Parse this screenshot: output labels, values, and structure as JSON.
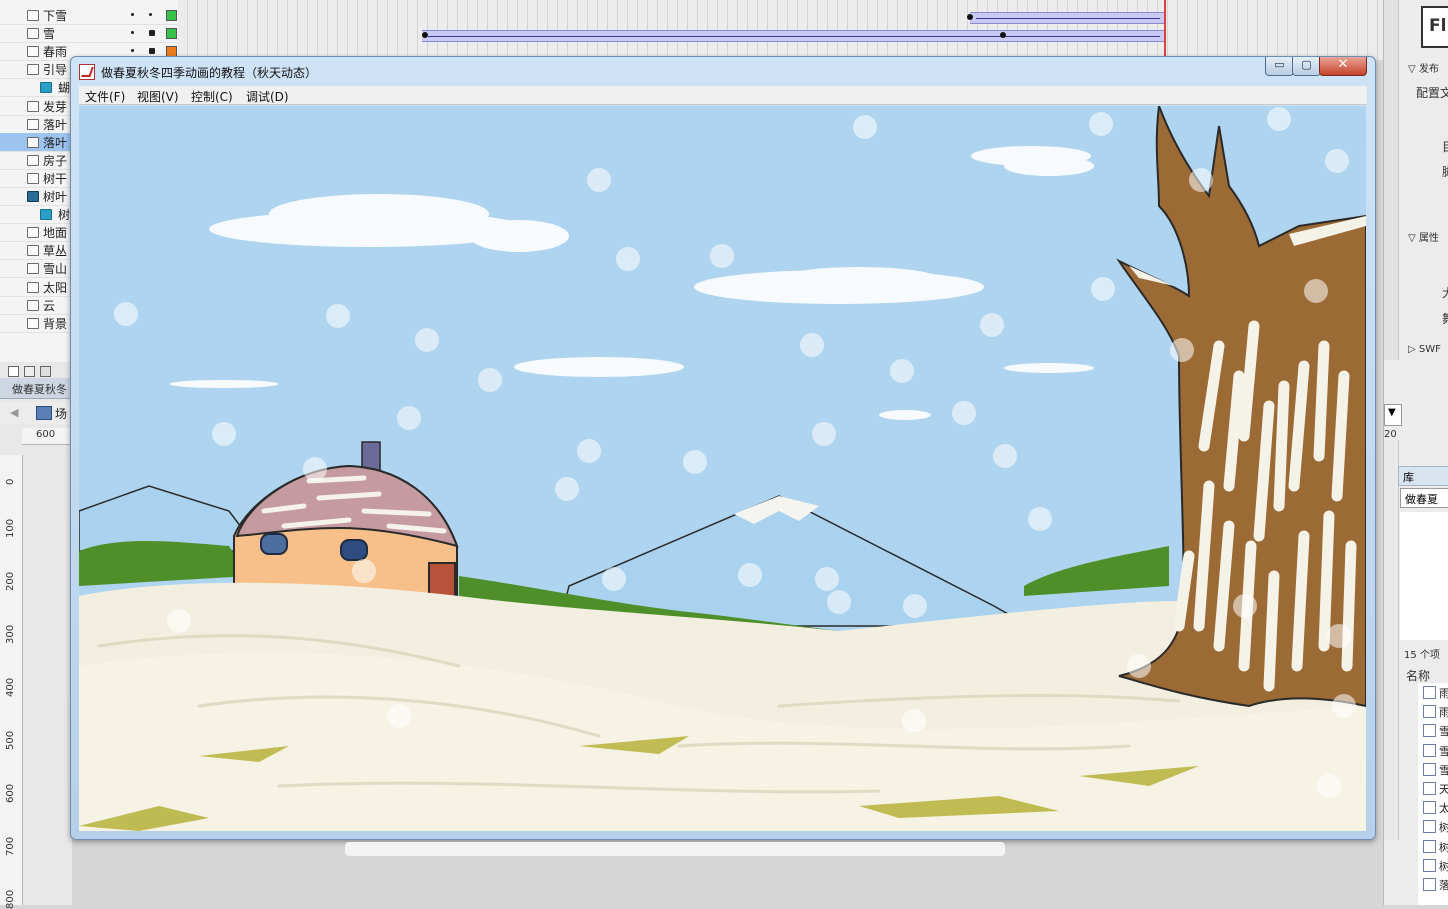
{
  "layers": [
    {
      "name": "下雪",
      "type": "layer",
      "color": "#39c24a"
    },
    {
      "name": "雪",
      "type": "layer",
      "color": "#39c24a"
    },
    {
      "name": "春雨",
      "type": "layer",
      "color": "#ef7b1e"
    },
    {
      "name": "引导",
      "type": "guide",
      "color": ""
    },
    {
      "name": "蝴",
      "type": "sub",
      "color": ""
    },
    {
      "name": "发芽",
      "type": "layer",
      "color": ""
    },
    {
      "name": "落叶",
      "type": "layer",
      "color": ""
    },
    {
      "name": "落叶",
      "type": "layer",
      "color": "",
      "selected": true
    },
    {
      "name": "房子",
      "type": "layer",
      "color": ""
    },
    {
      "name": "树干",
      "type": "layer",
      "color": ""
    },
    {
      "name": "树叶",
      "type": "folder",
      "color": ""
    },
    {
      "name": "树",
      "type": "sub",
      "color": ""
    },
    {
      "name": "地面",
      "type": "layer",
      "color": ""
    },
    {
      "name": "草丛",
      "type": "layer",
      "color": ""
    },
    {
      "name": "雪山",
      "type": "layer",
      "color": ""
    },
    {
      "name": "太阳",
      "type": "layer",
      "color": ""
    },
    {
      "name": "云",
      "type": "layer",
      "color": ""
    },
    {
      "name": "背景",
      "type": "layer",
      "color": ""
    }
  ],
  "left_panel": {
    "doc_tab": "做春夏秋冬",
    "scene": "场",
    "ruler_top": "600",
    "ruler_left": [
      "0",
      "100",
      "200",
      "300",
      "400",
      "500",
      "600",
      "700",
      "800"
    ]
  },
  "player": {
    "title": "做春夏秋冬四季动画的教程（秋天动态）",
    "menu": [
      "文件(F)",
      "视图(V)",
      "控制(C)",
      "调试(D)"
    ],
    "min": "▭",
    "max": "▢",
    "close": "✕"
  },
  "right_panel": {
    "top_label": "Fl",
    "publish": "发布",
    "profile": "配置文",
    "t1": "目",
    "t2": "脚",
    "properties": "属性",
    "t3": "大",
    "t4": "舞",
    "swf": "SWF",
    "ruler": "20",
    "library": "库",
    "lib_doc": "做春夏",
    "items_count": "15 个项",
    "name_col": "名称",
    "lib_items": [
      "雨",
      "雨",
      "雪",
      "雪",
      "雪",
      "天",
      "太",
      "树",
      "树",
      "树",
      "落"
    ]
  },
  "colors": {
    "sky": "#aed4ef",
    "snow": "#f3efe0",
    "bark": "#9c6a35",
    "house": "#f7c08a",
    "roof": "#c59aa0",
    "mountain": "#a9d2ee",
    "grass": "#4e8f2a",
    "selection": "#9cc4ef"
  }
}
